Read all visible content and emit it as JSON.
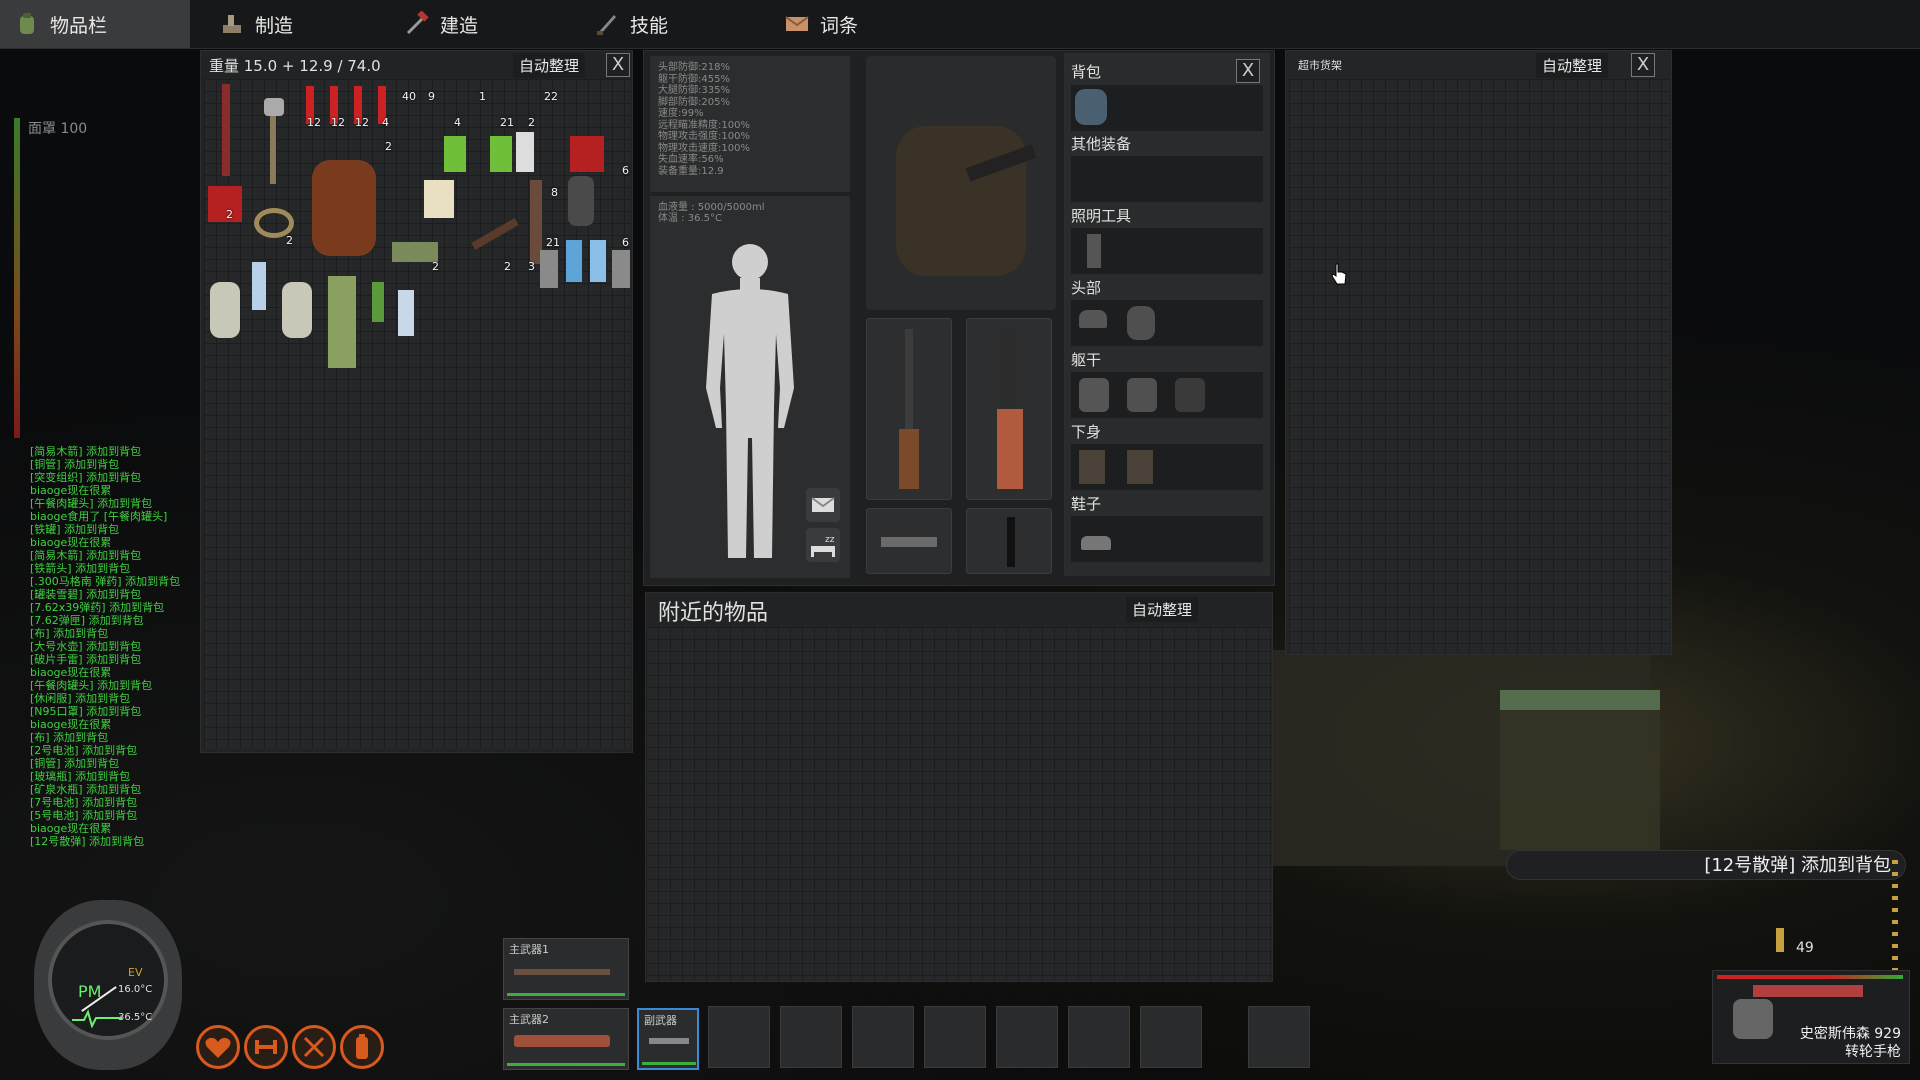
{
  "tabs": [
    {
      "label": "物品栏",
      "active": true,
      "icon": "backpack-icon"
    },
    {
      "label": "制造",
      "active": false,
      "icon": "craft-icon"
    },
    {
      "label": "建造",
      "active": false,
      "icon": "build-icon"
    },
    {
      "label": "技能",
      "active": false,
      "icon": "skill-icon"
    },
    {
      "label": "词条",
      "active": false,
      "icon": "mail-icon"
    }
  ],
  "hunger": {
    "label": "面罩 100",
    "value": 100
  },
  "inventory": {
    "weight": "重量 15.0 + 12.9 / 74.0",
    "auto_sort": "自动整理",
    "close": "X",
    "quantities": [
      "40",
      "9",
      "1",
      "22",
      "12",
      "12",
      "12",
      "4",
      "4",
      "21",
      "2",
      "2",
      "2",
      "6",
      "8",
      "2",
      "21",
      "6",
      "3",
      "2",
      "2"
    ]
  },
  "stats": {
    "lines": [
      "头部防御:218%",
      "躯干防御:455%",
      "大腿防御:335%",
      "脚部防御:205%",
      "速度:99%",
      "远程瞄准精度:100%",
      "物理攻击强度:100%",
      "物理攻击速度:100%",
      "失血速率:56%",
      "装备重量:12.9"
    ]
  },
  "character": {
    "water": "血液量 : 5000/5000ml",
    "temp": "体温 : 36.5°C"
  },
  "equipment": {
    "backpack": "背包",
    "other": "其他装备",
    "light": "照明工具",
    "head": "头部",
    "torso": "躯干",
    "legs": "下身",
    "shoes": "鞋子",
    "close": "X"
  },
  "nearby": {
    "title": "附近的物品",
    "auto_sort": "自动整理"
  },
  "container": {
    "title": "超市货架",
    "auto_sort": "自动整理",
    "close": "X"
  },
  "chat_log": [
    "[简易木箭] 添加到背包",
    "[铜管] 添加到背包",
    "[突变组织] 添加到背包",
    "biaoge现在很累",
    "[午餐肉罐头] 添加到背包",
    "biaoge食用了 [午餐肉罐头]",
    "[铁罐] 添加到背包",
    "biaoge现在很累",
    "[简易木箭] 添加到背包",
    "[铁箭头] 添加到背包",
    "[.300马格南 弹药] 添加到背包",
    "[罐装雪碧] 添加到背包",
    "[7.62x39弹药] 添加到背包",
    "[7.62弹匣] 添加到背包",
    "[布] 添加到背包",
    "[大号水壶] 添加到背包",
    "[破片手雷] 添加到背包",
    "biaoge现在很累",
    "[午餐肉罐头] 添加到背包",
    "[休闲服] 添加到背包",
    "[N95口罩] 添加到背包",
    "biaoge现在很累",
    "[布] 添加到背包",
    "[2号电池] 添加到背包",
    "[铜管] 添加到背包",
    "[玻璃瓶] 添加到背包",
    "[矿泉水瓶] 添加到背包",
    "[7号电池] 添加到背包",
    "[5号电池] 添加到背包",
    "biaoge现在很累",
    "[12号散弹] 添加到背包"
  ],
  "watch": {
    "period": "PM",
    "ev": "EV",
    "temp": "16.0°C",
    "body_temp": "36.5°C"
  },
  "hotbar": {
    "primary1": "主武器1",
    "primary2": "主武器2",
    "secondary": "副武器"
  },
  "toast": "[12号散弹] 添加到背包",
  "ammo": {
    "count": "49"
  },
  "weapon": {
    "name": "史密斯伟森 929",
    "type": "转轮手枪"
  }
}
